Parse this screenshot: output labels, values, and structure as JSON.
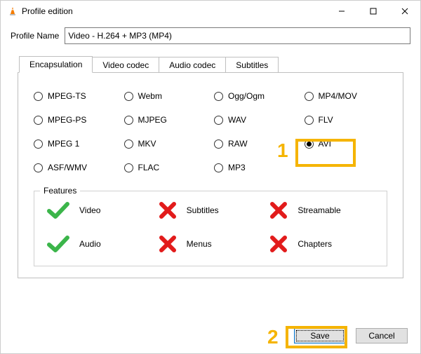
{
  "window": {
    "title": "Profile edition"
  },
  "profileName": {
    "label": "Profile Name",
    "value": "Video - H.264 + MP3 (MP4)"
  },
  "tabs": {
    "t0": "Encapsulation",
    "t1": "Video codec",
    "t2": "Audio codec",
    "t3": "Subtitles"
  },
  "encaps": {
    "r0": "MPEG-TS",
    "r1": "Webm",
    "r2": "Ogg/Ogm",
    "r3": "MP4/MOV",
    "r4": "MPEG-PS",
    "r5": "MJPEG",
    "r6": "WAV",
    "r7": "FLV",
    "r8": "MPEG 1",
    "r9": "MKV",
    "r10": "RAW",
    "r11": "AVI",
    "r12": "ASF/WMV",
    "r13": "FLAC",
    "r14": "MP3"
  },
  "features": {
    "legend": "Features",
    "f0": "Video",
    "f1": "Subtitles",
    "f2": "Streamable",
    "f3": "Audio",
    "f4": "Menus",
    "f5": "Chapters"
  },
  "buttons": {
    "save": "Save",
    "cancel": "Cancel"
  },
  "annotations": {
    "n1": "1",
    "n2": "2"
  }
}
